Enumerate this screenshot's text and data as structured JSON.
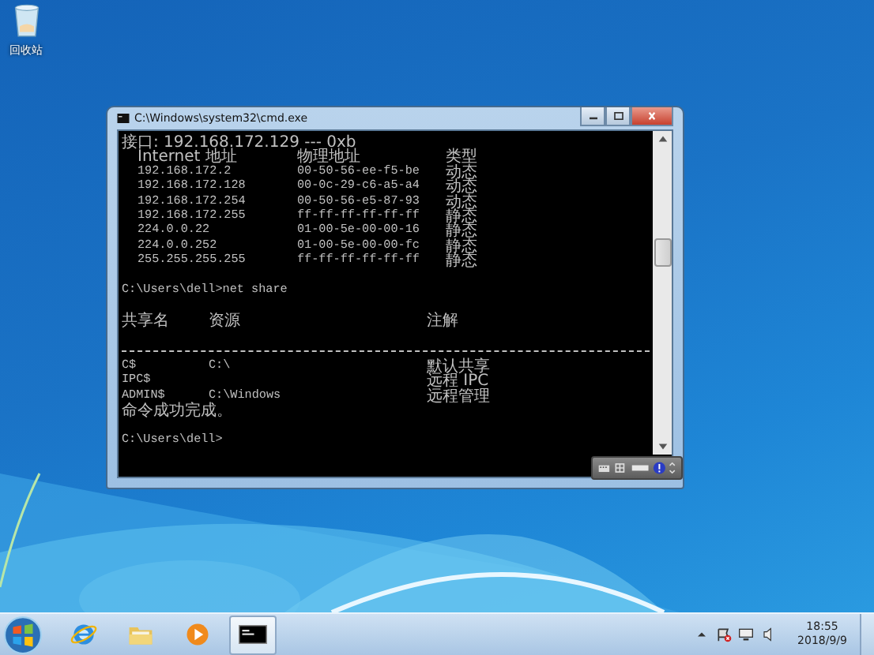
{
  "desktop": {
    "icons": [
      {
        "label": "回收站"
      }
    ]
  },
  "window": {
    "title": "C:\\Windows\\system32\\cmd.exe",
    "console": [
      {
        "kind": "message",
        "text": "接口: 192.168.172.129 --- 0xb"
      },
      {
        "kind": "arp-header",
        "columns": [
          "Internet 地址",
          "物理地址",
          "类型"
        ]
      },
      {
        "kind": "arp",
        "address": "192.168.172.2",
        "physical": "00-50-56-ee-f5-be",
        "type": "动态"
      },
      {
        "kind": "arp",
        "address": "192.168.172.128",
        "physical": "00-0c-29-c6-a5-a4",
        "type": "动态"
      },
      {
        "kind": "arp",
        "address": "192.168.172.254",
        "physical": "00-50-56-e5-87-93",
        "type": "动态"
      },
      {
        "kind": "arp",
        "address": "192.168.172.255",
        "physical": "ff-ff-ff-ff-ff-ff",
        "type": "静态"
      },
      {
        "kind": "arp",
        "address": "224.0.0.22",
        "physical": "01-00-5e-00-00-16",
        "type": "静态"
      },
      {
        "kind": "arp",
        "address": "224.0.0.252",
        "physical": "01-00-5e-00-00-fc",
        "type": "静态"
      },
      {
        "kind": "arp",
        "address": "255.255.255.255",
        "physical": "ff-ff-ff-ff-ff-ff",
        "type": "静态"
      },
      {
        "kind": "blank"
      },
      {
        "kind": "prompt",
        "text": "C:\\Users\\dell>net share"
      },
      {
        "kind": "blank"
      },
      {
        "kind": "share-header",
        "columns": [
          "共享名",
          "资源",
          "注解"
        ]
      },
      {
        "kind": "blank"
      },
      {
        "kind": "rule"
      },
      {
        "kind": "share",
        "name": "C$",
        "resource": "C:\\",
        "remark": "默认共享"
      },
      {
        "kind": "share",
        "name": "IPC$",
        "remark": "远程 IPC"
      },
      {
        "kind": "share",
        "name": "ADMIN$",
        "resource": "C:\\Windows",
        "remark": "远程管理"
      },
      {
        "kind": "message",
        "text": "命令成功完成。"
      },
      {
        "kind": "blank"
      },
      {
        "kind": "prompt",
        "text": "C:\\Users\\dell>"
      }
    ]
  },
  "taskbar": {
    "apps": [
      {
        "kind": "ie",
        "selected": false
      },
      {
        "kind": "folder",
        "selected": false
      },
      {
        "kind": "media",
        "selected": false
      },
      {
        "kind": "cmd",
        "selected": true
      }
    ],
    "clock": {
      "time": "18:55",
      "date": "2018/9/9"
    }
  }
}
